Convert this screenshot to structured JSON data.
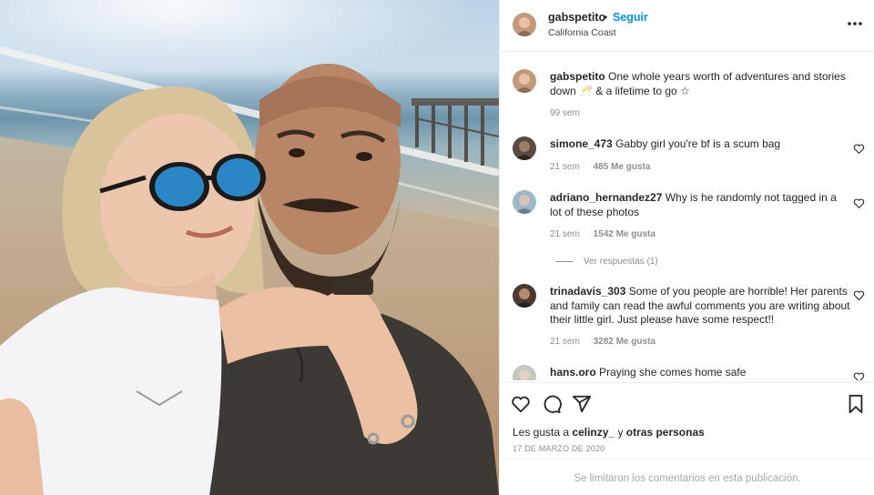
{
  "post": {
    "username": "gabspetito",
    "separator": "•",
    "follow_label": "Seguir",
    "location": "California Coast",
    "avatar_icon": "profile-avatar-icon"
  },
  "comments": [
    {
      "username": "gabspetito",
      "text": "One whole years worth of adventures and stories down 🥂 & a lifetime to go ☆",
      "time": "99 sem",
      "likes": "",
      "is_caption": true
    },
    {
      "username": "simone_473",
      "text": "Gabby girl you're bf is a scum bag",
      "time": "21 sem",
      "likes": "485 Me gusta"
    },
    {
      "username": "adriano_hernandez27",
      "text": "Why is he randomly not tagged in a lot of these photos",
      "time": "21 sem",
      "likes": "1542 Me gusta",
      "replies": "Ver respuestas (1)"
    },
    {
      "username": "trinadavis_303",
      "text": "Some of you people are horrible! Her parents and family can read the awful comments you are writing about their little girl. Just please have some respect!!",
      "time": "21 sem",
      "likes": "3282 Me gusta"
    },
    {
      "username": "hans.oro",
      "text": "Praying she comes home safe",
      "time": "",
      "likes": ""
    }
  ],
  "likes_summary": {
    "prefix": "Les gusta a",
    "user": "celinzy_",
    "connector": "y",
    "others": "otras personas"
  },
  "date": "17 DE MARZO DE 2020",
  "comments_limited": "Se limitaron los comentarios en esta publicación.",
  "colors": {
    "link_blue": "#0095f6",
    "text": "#262626",
    "muted": "#8e8e8e",
    "border": "#efefef"
  },
  "icons": [
    "more-options-icon",
    "heart-icon",
    "comment-icon",
    "share-icon",
    "bookmark-icon"
  ]
}
